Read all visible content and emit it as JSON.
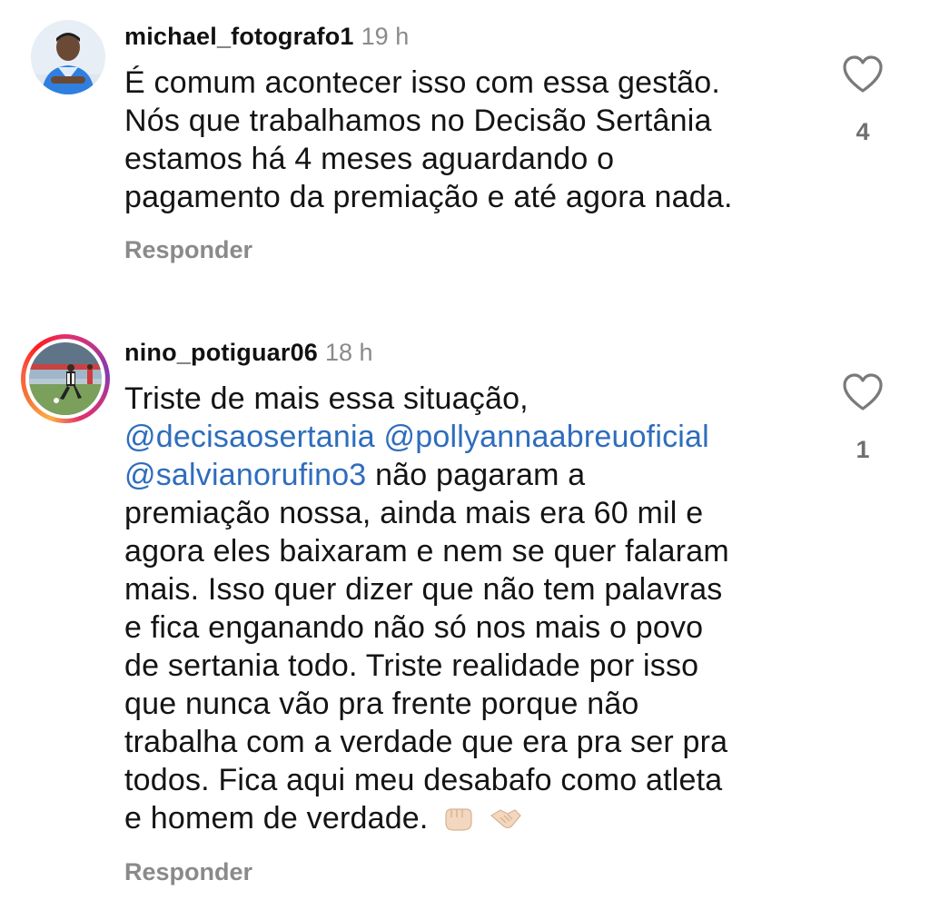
{
  "comments": [
    {
      "username": "michael_fotografo1",
      "time": "19 h",
      "lines": [
        "É comum acontecer isso com essa gestão.",
        "Nós que trabalhamos no Decisão Sertânia",
        "estamos há 4 meses aguardando o",
        "pagamento da premiação e até agora nada."
      ],
      "reply_label": "Responder",
      "like_count": "4",
      "avatar_icon": "profile-photo-man-blue-shirt"
    },
    {
      "username": "nino_potiguar06",
      "time": "18 h",
      "line1": "Triste de mais essa situação,",
      "mention1": "@decisaosertania",
      "mention2": "@pollyannaabreuoficial",
      "mention3": "@salvianorufino3",
      "line3_rest": " não pagaram a",
      "lines_rest": [
        "premiação nossa, ainda mais era 60 mil e",
        "agora eles baixaram e nem se quer falaram",
        "mais. Isso quer dizer que não tem palavras",
        "e fica enganando não só nos mais o povo",
        "de sertania todo. Triste realidade por isso",
        "que nunca vão pra frente porque não",
        "trabalha com a verdade que era pra ser pra",
        "todos. Fica aqui meu desabafo como atleta"
      ],
      "last_line": "e homem de verdade.",
      "emojis": [
        "fist-emoji",
        "handshake-emoji"
      ],
      "reply_label": "Responder",
      "like_count": "1",
      "avatar_icon": "profile-photo-soccer-player",
      "story_ring": true
    }
  ],
  "colors": {
    "mention": "#2e6dbd",
    "secondary_text": "#8a8a8a",
    "story_ring_start": "#fcaf45",
    "story_ring_end": "#833ab4"
  }
}
